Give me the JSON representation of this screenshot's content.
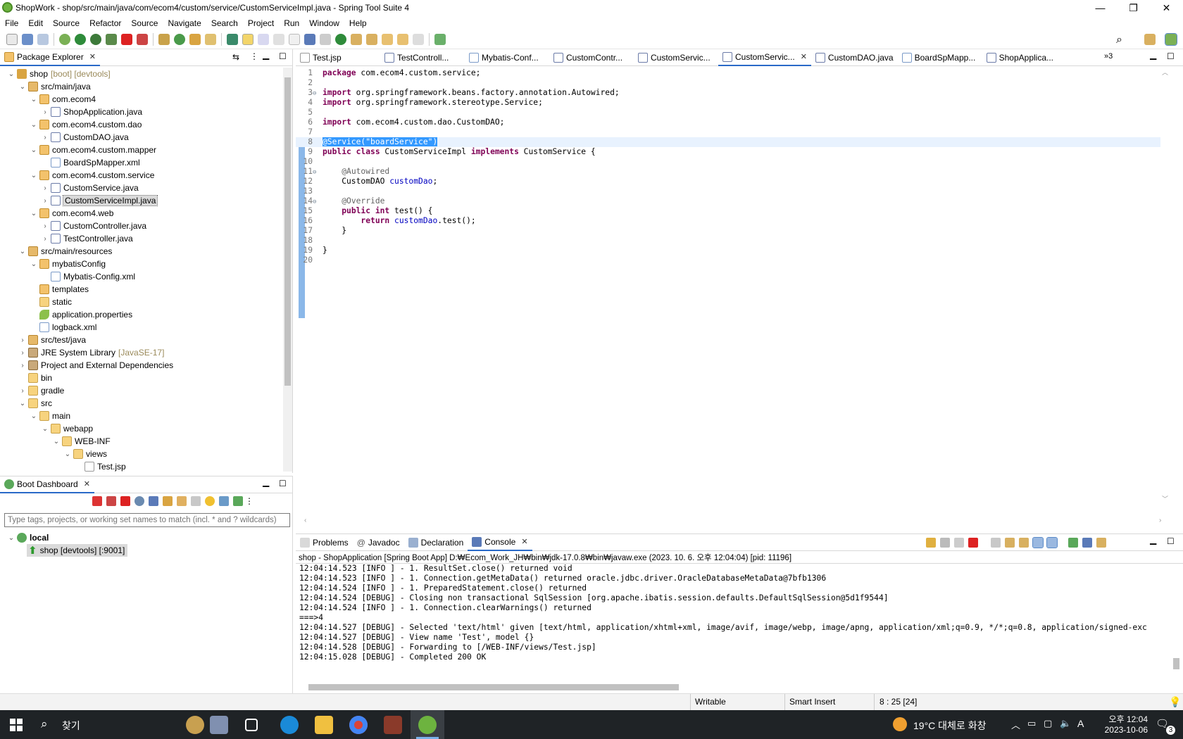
{
  "window": {
    "title": "ShopWork - shop/src/main/java/com/ecom4/custom/service/CustomServiceImpl.java - Spring Tool Suite 4",
    "minimize": "—",
    "maximize": "❐",
    "close": "✕"
  },
  "menu": [
    "File",
    "Edit",
    "Source",
    "Refactor",
    "Source",
    "Navigate",
    "Search",
    "Project",
    "Run",
    "Window",
    "Help"
  ],
  "package_explorer": {
    "title": "Package Explorer",
    "tree": [
      {
        "indent": 0,
        "twisty": "⌄",
        "icon": "proj",
        "label": "shop",
        "suffix": "[boot] [devtools]"
      },
      {
        "indent": 1,
        "twisty": "⌄",
        "icon": "srcfolder",
        "label": "src/main/java"
      },
      {
        "indent": 2,
        "twisty": "⌄",
        "icon": "pkg",
        "label": "com.ecom4"
      },
      {
        "indent": 3,
        "twisty": "›",
        "icon": "java",
        "label": "ShopApplication.java"
      },
      {
        "indent": 2,
        "twisty": "⌄",
        "icon": "pkg",
        "label": "com.ecom4.custom.dao"
      },
      {
        "indent": 3,
        "twisty": "›",
        "icon": "java",
        "label": "CustomDAO.java"
      },
      {
        "indent": 2,
        "twisty": "⌄",
        "icon": "pkg",
        "label": "com.ecom4.custom.mapper"
      },
      {
        "indent": 3,
        "twisty": "",
        "icon": "xml",
        "label": "BoardSpMapper.xml"
      },
      {
        "indent": 2,
        "twisty": "⌄",
        "icon": "pkg",
        "label": "com.ecom4.custom.service"
      },
      {
        "indent": 3,
        "twisty": "›",
        "icon": "java",
        "label": "CustomService.java"
      },
      {
        "indent": 3,
        "twisty": "›",
        "icon": "java",
        "label": "CustomServiceImpl.java",
        "selected": true
      },
      {
        "indent": 2,
        "twisty": "⌄",
        "icon": "pkg",
        "label": "com.ecom4.web"
      },
      {
        "indent": 3,
        "twisty": "›",
        "icon": "java",
        "label": "CustomController.java"
      },
      {
        "indent": 3,
        "twisty": "›",
        "icon": "java",
        "label": "TestController.java"
      },
      {
        "indent": 1,
        "twisty": "⌄",
        "icon": "srcfolder",
        "label": "src/main/resources"
      },
      {
        "indent": 2,
        "twisty": "⌄",
        "icon": "pkg",
        "label": "mybatisConfig"
      },
      {
        "indent": 3,
        "twisty": "",
        "icon": "xml",
        "label": "Mybatis-Config.xml"
      },
      {
        "indent": 2,
        "twisty": "",
        "icon": "pkg",
        "label": "templates"
      },
      {
        "indent": 2,
        "twisty": "",
        "icon": "folder",
        "label": "static"
      },
      {
        "indent": 2,
        "twisty": "",
        "icon": "leaf",
        "label": "application.properties"
      },
      {
        "indent": 2,
        "twisty": "",
        "icon": "xml",
        "label": "logback.xml"
      },
      {
        "indent": 1,
        "twisty": "›",
        "icon": "srcfolder",
        "label": "src/test/java"
      },
      {
        "indent": 1,
        "twisty": "›",
        "icon": "lib",
        "label": "JRE System Library",
        "suffix": "[JavaSE-17]"
      },
      {
        "indent": 1,
        "twisty": "›",
        "icon": "lib",
        "label": "Project and External Dependencies"
      },
      {
        "indent": 1,
        "twisty": "",
        "icon": "folder",
        "label": "bin"
      },
      {
        "indent": 1,
        "twisty": "›",
        "icon": "folder",
        "label": "gradle"
      },
      {
        "indent": 1,
        "twisty": "⌄",
        "icon": "folder",
        "label": "src"
      },
      {
        "indent": 2,
        "twisty": "⌄",
        "icon": "folder",
        "label": "main"
      },
      {
        "indent": 3,
        "twisty": "⌄",
        "icon": "folder",
        "label": "webapp"
      },
      {
        "indent": 4,
        "twisty": "⌄",
        "icon": "folder",
        "label": "WEB-INF"
      },
      {
        "indent": 5,
        "twisty": "⌄",
        "icon": "folder",
        "label": "views"
      },
      {
        "indent": 6,
        "twisty": "",
        "icon": "jsp",
        "label": "Test.jsp"
      }
    ]
  },
  "boot_dashboard": {
    "title": "Boot Dashboard",
    "filter_placeholder": "Type tags, projects, or working set names to match (incl. * and ? wildcards)",
    "local_label": "local",
    "app_label": "shop [devtools] [:9001]"
  },
  "editor": {
    "tabs": [
      {
        "label": "Test.jsp",
        "icon": "jsp"
      },
      {
        "label": "TestControll...",
        "icon": "java"
      },
      {
        "label": "Mybatis-Conf...",
        "icon": "xml"
      },
      {
        "label": "CustomContr...",
        "icon": "java"
      },
      {
        "label": "CustomServic...",
        "icon": "java"
      },
      {
        "label": "CustomServic...",
        "icon": "java",
        "active": true
      },
      {
        "label": "CustomDAO.java",
        "icon": "java"
      },
      {
        "label": "BoardSpMapp...",
        "icon": "xml"
      },
      {
        "label": "ShopApplica...",
        "icon": "java"
      }
    ],
    "overflow_label": "»3",
    "lines": [
      {
        "n": "1",
        "tokens": [
          [
            "kw",
            "package"
          ],
          [
            "",
            "com.ecom4.custom.service;"
          ]
        ]
      },
      {
        "n": "2",
        "tokens": []
      },
      {
        "n": "3",
        "fold": "⊖",
        "tokens": [
          [
            "kw",
            "import"
          ],
          [
            "",
            "org.springframework.beans.factory.annotation.Autowired;"
          ]
        ]
      },
      {
        "n": "4",
        "tokens": [
          [
            "kw",
            "import"
          ],
          [
            "",
            "org.springframework.stereotype.Service;"
          ]
        ]
      },
      {
        "n": "5",
        "tokens": []
      },
      {
        "n": "6",
        "tokens": [
          [
            "kw",
            "import"
          ],
          [
            "",
            "com.ecom4.custom.dao.CustomDAO;"
          ]
        ]
      },
      {
        "n": "7",
        "tokens": []
      },
      {
        "n": "8",
        "highlight": true,
        "tokens": [
          [
            "sel",
            "@Service(\"boardService\")"
          ]
        ]
      },
      {
        "n": "9",
        "tokens": [
          [
            "kw",
            "public class"
          ],
          [
            "",
            " CustomServiceImpl "
          ],
          [
            "kw",
            "implements"
          ],
          [
            "",
            " CustomService {"
          ]
        ]
      },
      {
        "n": "10",
        "tokens": []
      },
      {
        "n": "11",
        "fold": "⊖",
        "tokens": [
          [
            "",
            "    "
          ],
          [
            "ann",
            "@Autowired"
          ]
        ]
      },
      {
        "n": "12",
        "tokens": [
          [
            "",
            "    CustomDAO "
          ],
          [
            "fld",
            "customDao"
          ],
          [
            "",
            ";"
          ]
        ]
      },
      {
        "n": "13",
        "tokens": []
      },
      {
        "n": "14",
        "fold": "⊖",
        "tokens": [
          [
            "",
            "    "
          ],
          [
            "ann",
            "@Override"
          ]
        ]
      },
      {
        "n": "15",
        "tokens": [
          [
            "",
            "    "
          ],
          [
            "kw",
            "public int"
          ],
          [
            "",
            " test() {"
          ]
        ]
      },
      {
        "n": "16",
        "tokens": [
          [
            "",
            "        "
          ],
          [
            "kw",
            "return"
          ],
          [
            "",
            " "
          ],
          [
            "fld",
            "customDao"
          ],
          [
            "",
            ".test();"
          ]
        ]
      },
      {
        "n": "17",
        "tokens": [
          [
            "",
            "    }"
          ]
        ]
      },
      {
        "n": "18",
        "tokens": []
      },
      {
        "n": "19",
        "tokens": [
          [
            "",
            "}"
          ]
        ]
      },
      {
        "n": "20",
        "tokens": []
      }
    ]
  },
  "bottom_panel": {
    "tabs": [
      "Problems",
      "Javadoc",
      "Declaration",
      "Console"
    ],
    "active_tab": "Console",
    "console_header": "shop - ShopApplication [Spring Boot App] D:₩Ecom_Work_JH₩bin₩jdk-17.0.8₩bin₩javaw.exe  (2023. 10. 6. 오후 12:04:04) [pid: 11196]",
    "console_lines": [
      "12:04:14.523 [INFO ] - 1. ResultSet.close() returned void",
      "12:04:14.523 [INFO ] - 1. Connection.getMetaData() returned oracle.jdbc.driver.OracleDatabaseMetaData@7bfb1306",
      "12:04:14.524 [INFO ] - 1. PreparedStatement.close() returned",
      "12:04:14.524 [DEBUG] - Closing non transactional SqlSession [org.apache.ibatis.session.defaults.DefaultSqlSession@5d1f9544]",
      "12:04:14.524 [INFO ] - 1. Connection.clearWarnings() returned",
      "===>4",
      "12:04:14.527 [DEBUG] - Selected 'text/html' given [text/html, application/xhtml+xml, image/avif, image/webp, image/apng, application/xml;q=0.9, */*;q=0.8, application/signed-exc",
      "12:04:14.527 [DEBUG] - View name 'Test', model {}",
      "12:04:14.528 [DEBUG] - Forwarding to [/WEB-INF/views/Test.jsp]",
      "12:04:15.028 [DEBUG] - Completed 200 OK"
    ]
  },
  "status": {
    "writable": "Writable",
    "insert_mode": "Smart Insert",
    "position": "8 : 25 [24]"
  },
  "taskbar": {
    "search_label": "찾기",
    "weather": "19°C 대체로 화창",
    "time": "오후 12:04",
    "date": "2023-10-06",
    "ime": "A",
    "notif_count": "3"
  },
  "colors": {
    "accent": "#2a6ac8",
    "selection_line": "#e8f2fe",
    "keyword": "#7f0055",
    "taskbar": "#1f2326"
  }
}
